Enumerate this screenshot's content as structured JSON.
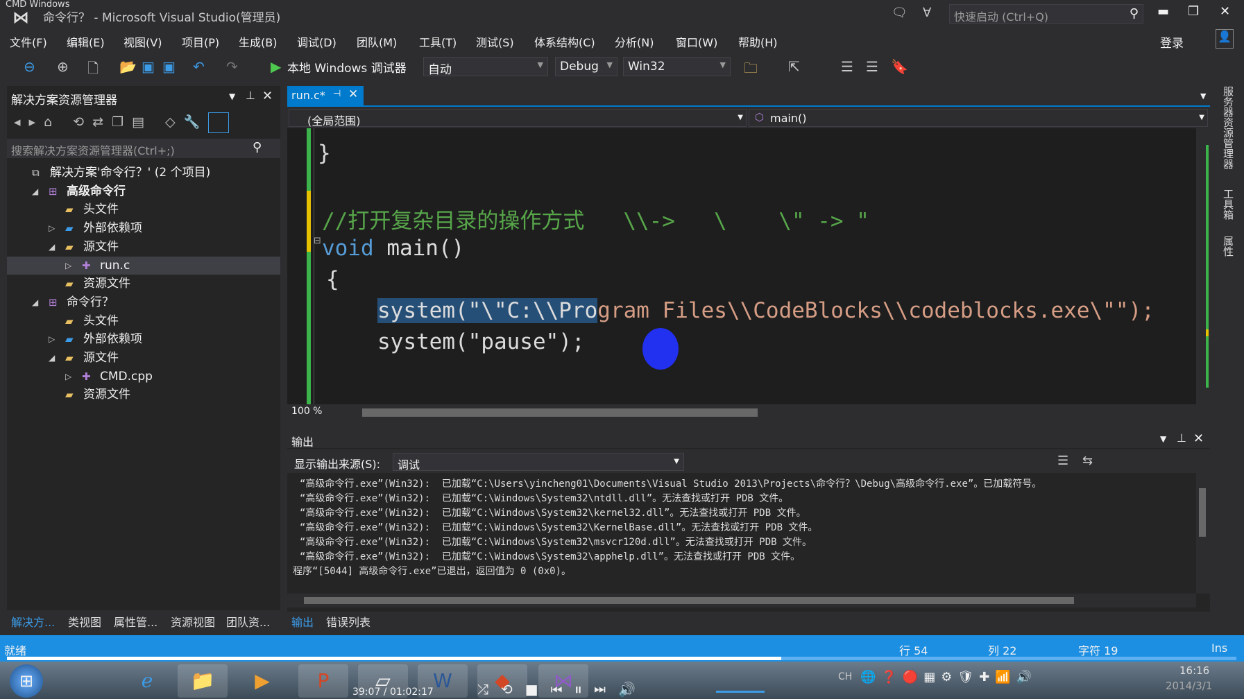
{
  "window": {
    "caption": "CMD Windows",
    "title": "命令行？ - Microsoft Visual Studio(管理员)",
    "quick_launch_placeholder": "快速启动 (Ctrl+Q)",
    "sign_in": "登录"
  },
  "menu": [
    "文件(F)",
    "编辑(E)",
    "视图(V)",
    "项目(P)",
    "生成(B)",
    "调试(D)",
    "团队(M)",
    "工具(T)",
    "测试(S)",
    "体系结构(C)",
    "分析(N)",
    "窗口(W)",
    "帮助(H)"
  ],
  "toolbar": {
    "debugger": "本地 Windows 调试器",
    "solution_config": "自动",
    "config": "Debug",
    "platform": "Win32"
  },
  "solution_explorer": {
    "title": "解决方案资源管理器",
    "search_placeholder": "搜索解决方案资源管理器(Ctrl+;)",
    "tree": [
      {
        "label": "解决方案'命令行？' (2 个项目)",
        "level": 0,
        "expander": "",
        "icon": "solution-icon"
      },
      {
        "label": "高级命令行",
        "level": 1,
        "expander": "◢",
        "icon": "project-icon",
        "bold": true
      },
      {
        "label": "头文件",
        "level": 2,
        "expander": "",
        "icon": "folder-icon"
      },
      {
        "label": "外部依赖项",
        "level": 2,
        "expander": "▷",
        "icon": "dependencies-icon"
      },
      {
        "label": "源文件",
        "level": 2,
        "expander": "◢",
        "icon": "folder-icon"
      },
      {
        "label": "run.c",
        "level": 3,
        "expander": "▷",
        "icon": "cpp-file-icon",
        "selected": true
      },
      {
        "label": "资源文件",
        "level": 2,
        "expander": "",
        "icon": "folder-icon"
      },
      {
        "label": "命令行？",
        "level": 1,
        "expander": "◢",
        "icon": "project-icon"
      },
      {
        "label": "头文件",
        "level": 2,
        "expander": "",
        "icon": "folder-icon"
      },
      {
        "label": "外部依赖项",
        "level": 2,
        "expander": "▷",
        "icon": "dependencies-icon"
      },
      {
        "label": "源文件",
        "level": 2,
        "expander": "◢",
        "icon": "folder-icon"
      },
      {
        "label": "CMD.cpp",
        "level": 3,
        "expander": "▷",
        "icon": "cpp-file-icon"
      },
      {
        "label": "资源文件",
        "level": 2,
        "expander": "",
        "icon": "folder-icon"
      }
    ],
    "bottom_tabs": [
      "解决方...",
      "类视图",
      "属性管...",
      "资源视图",
      "团队资..."
    ]
  },
  "editor": {
    "tab": "run.c*",
    "scope": "(全局范围)",
    "member": "main()",
    "zoom": "100 %",
    "lines": [
      {
        "text": "}",
        "color": "#dcdcdc"
      },
      {
        "text": "//打开复杂目录的操作方式   \\\\->   \\    \\\" -> \"",
        "color": "#57a64a"
      },
      {
        "text": "void",
        "color": "#569cd6",
        "rest": " main()"
      },
      {
        "text": "{",
        "color": "#dcdcdc"
      },
      {
        "sel": "system(\"\\\"C:\\\\Pro",
        "rest": "gram Files\\\\CodeBlocks\\\\codeblocks.exe\\\"\");",
        "color": "#d69d85"
      },
      {
        "text": "system(\"pause\");",
        "color": "#dcdcdc"
      }
    ]
  },
  "right_rail": [
    "服务器资源管理器",
    "工具箱",
    "属性"
  ],
  "output": {
    "title": "输出",
    "source_label": "显示输出来源(S):",
    "source": "调试",
    "lines": [
      "“高级命令行.exe”(Win32):  已加载“C:\\Users\\yincheng01\\Documents\\Visual Studio 2013\\Projects\\命令行？\\Debug\\高级命令行.exe”。已加载符号。",
      "“高级命令行.exe”(Win32):  已加载“C:\\Windows\\System32\\ntdll.dll”。无法查找或打开 PDB 文件。",
      "“高级命令行.exe”(Win32):  已加载“C:\\Windows\\System32\\kernel32.dll”。无法查找或打开 PDB 文件。",
      "“高级命令行.exe”(Win32):  已加载“C:\\Windows\\System32\\KernelBase.dll”。无法查找或打开 PDB 文件。",
      "“高级命令行.exe”(Win32):  已加载“C:\\Windows\\System32\\msvcr120d.dll”。无法查找或打开 PDB 文件。",
      "“高级命令行.exe”(Win32):  已加载“C:\\Windows\\System32\\apphelp.dll”。无法查找或打开 PDB 文件。",
      "程序“[5044] 高级命令行.exe”已退出，返回值为 0 (0x0)。"
    ],
    "tabs": [
      "输出",
      "错误列表"
    ]
  },
  "status": {
    "ready": "就绪",
    "line": "行 54",
    "col": "列 22",
    "char": "字符 19",
    "mode": "Ins"
  },
  "taskbar": {
    "media_time": "39:07 / 01:02:17",
    "media_progress": 0.63,
    "clock_time": "16:16",
    "clock_date": "2014/3/1",
    "ime": "CH"
  },
  "colors": {
    "accent": "#1c8fe3",
    "selection": "#264f78",
    "comment": "#57a64a",
    "keyword": "#569cd6",
    "string": "#d69d85"
  }
}
